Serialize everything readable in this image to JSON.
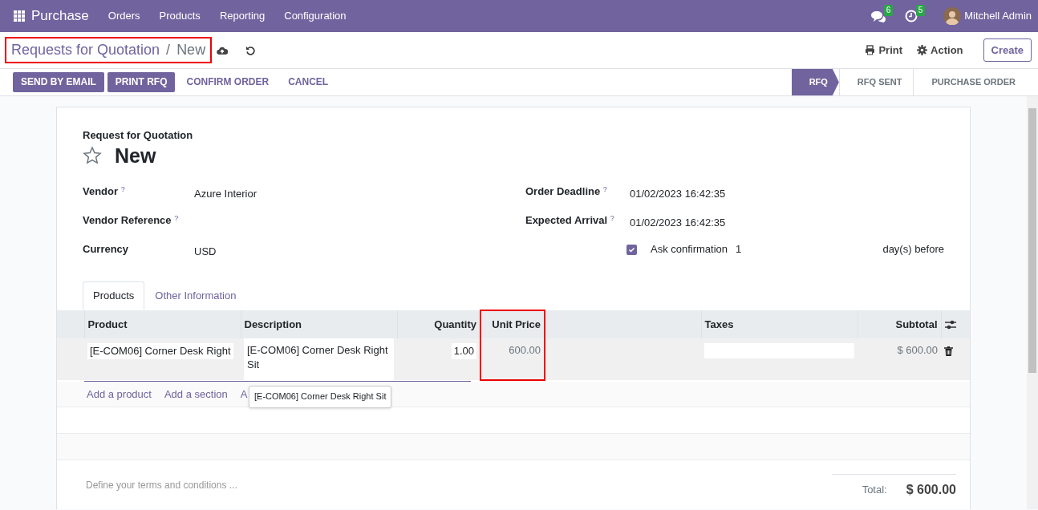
{
  "navbar": {
    "app": "Purchase",
    "menus": [
      "Orders",
      "Products",
      "Reporting",
      "Configuration"
    ],
    "messages_count": "6",
    "activities_count": "5",
    "user": "Mitchell Admin"
  },
  "breadcrumb": {
    "parent": "Requests for Quotation",
    "separator": "/",
    "current": "New",
    "highlighted": true
  },
  "actions": [
    {
      "label": "Print",
      "kind": "print"
    },
    {
      "label": "Action",
      "kind": "gear"
    }
  ],
  "create_button": "Create",
  "header_buttons": [
    {
      "label": "SEND BY EMAIL",
      "primary": true
    },
    {
      "label": "PRINT RFQ",
      "primary": true
    },
    {
      "label": "CONFIRM ORDER",
      "primary": false
    },
    {
      "label": "CANCEL",
      "primary": false
    }
  ],
  "stages": [
    {
      "label": "RFQ",
      "selected": true
    },
    {
      "label": "RFQ SENT",
      "selected": false
    },
    {
      "label": "PURCHASE ORDER",
      "selected": false
    }
  ],
  "form": {
    "subtitle": "Request for Quotation",
    "title": "New",
    "starred": false,
    "left_fields": [
      {
        "label": "Vendor",
        "help": "?",
        "value": "Azure Interior"
      },
      {
        "label": "Vendor Reference",
        "help": "?"
      },
      {
        "label": "Currency",
        "value": "USD"
      }
    ],
    "right_fields": [
      {
        "label": "Order Deadline",
        "help": "?",
        "value": "01/02/2023 16:42:35"
      },
      {
        "label": "Expected Arrival",
        "help": "?",
        "value": "01/02/2023 16:42:35"
      }
    ],
    "ask_confirmation": {
      "checked": true,
      "label": "Ask confirmation",
      "days": "1",
      "suffix": "day(s) before"
    }
  },
  "tabs": [
    {
      "label": "Products",
      "selected": true
    },
    {
      "label": "Other Information",
      "selected": false
    }
  ],
  "table": {
    "columns": [
      {
        "label": "Product",
        "kind": "data"
      },
      {
        "label": "Description",
        "kind": "data"
      },
      {
        "label": "Quantity",
        "kind": "data"
      },
      {
        "label": "Unit Price",
        "kind": "data",
        "highlighted": true
      },
      {
        "kind": "spacer"
      },
      {
        "label": "Taxes",
        "kind": "data"
      },
      {
        "label": "Subtotal",
        "kind": "data"
      }
    ],
    "rows": [
      {
        "cells": [
          {
            "kind": "input",
            "text": "[E-COM06] Corner Desk Right"
          },
          {
            "kind": "textarea",
            "text": "[E-COM06] Corner Desk Right Sit"
          },
          {
            "kind": "input",
            "text": "1.00"
          },
          {
            "kind": "text",
            "text": "600.00"
          },
          "",
          {
            "kind": "input"
          },
          {
            "kind": "text",
            "text": "$ 600.00"
          }
        ]
      }
    ]
  },
  "add_links": [
    "Add a product",
    "Add a section",
    "A"
  ],
  "tooltip": "[E-COM06] Corner Desk Right Sit",
  "terms_placeholder": "Define your terms and conditions ...",
  "total": {
    "label": "Total:",
    "value": "$ 600.00"
  }
}
